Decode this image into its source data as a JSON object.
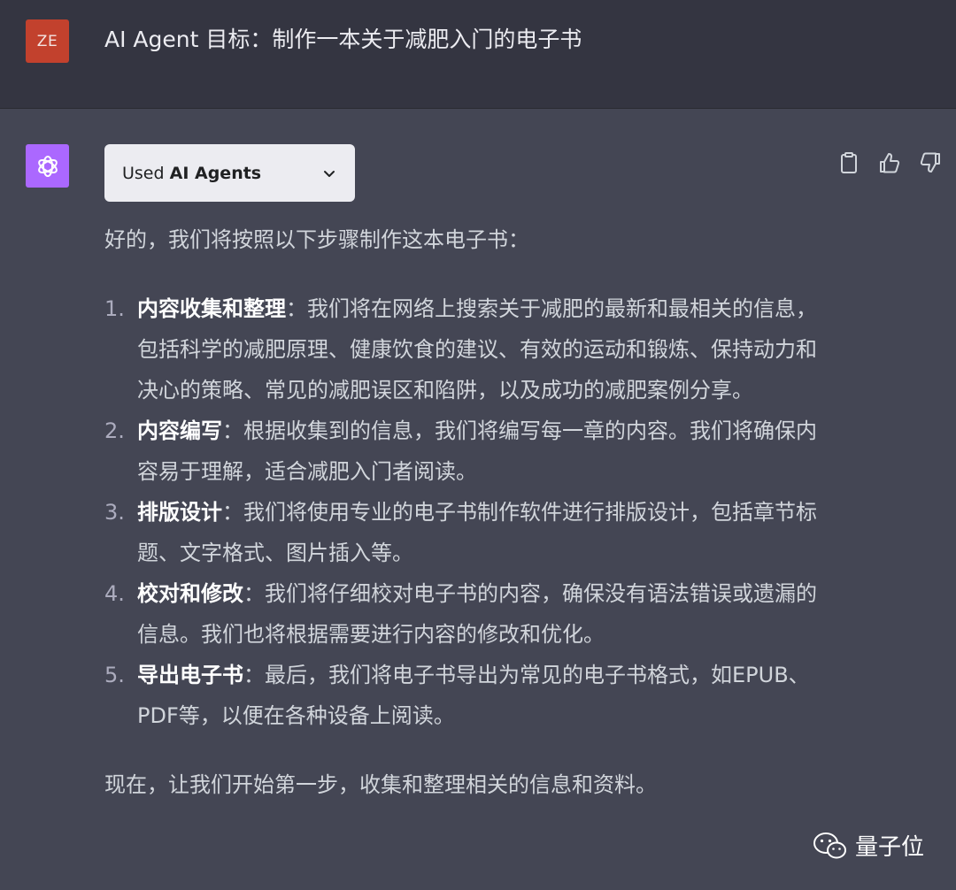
{
  "user_message": {
    "avatar_initials": "ZE",
    "avatar_color": "#c2412d",
    "text": "AI Agent 目标：制作一本关于减肥入门的电子书"
  },
  "assistant": {
    "avatar_icon": "openai-logo-icon",
    "avatar_color": "#ab68ff",
    "tool_prefix": "Used ",
    "tool_name": "AI Agents",
    "actions": [
      "clipboard-icon",
      "thumbs-up-icon",
      "thumbs-down-icon"
    ],
    "intro": "好的，我们将按照以下步骤制作这本电子书：",
    "steps": [
      {
        "number": "1.",
        "title": "内容收集和整理",
        "sep": "：",
        "body": "我们将在网络上搜索关于减肥的最新和最相关的信息，包括科学的减肥原理、健康饮食的建议、有效的运动和锻炼、保持动力和决心的策略、常见的减肥误区和陷阱，以及成功的减肥案例分享。"
      },
      {
        "number": "2.",
        "title": "内容编写",
        "sep": "：",
        "body": "根据收集到的信息，我们将编写每一章的内容。我们将确保内容易于理解，适合减肥入门者阅读。"
      },
      {
        "number": "3.",
        "title": "排版设计",
        "sep": "：",
        "body": "我们将使用专业的电子书制作软件进行排版设计，包括章节标题、文字格式、图片插入等。"
      },
      {
        "number": "4.",
        "title": "校对和修改",
        "sep": "：",
        "body": "我们将仔细校对电子书的内容，确保没有语法错误或遗漏的信息。我们也将根据需要进行内容的修改和优化。"
      },
      {
        "number": "5.",
        "title": "导出电子书",
        "sep": "：",
        "body": "最后，我们将电子书导出为常见的电子书格式，如EPUB、PDF等，以便在各种设备上阅读。"
      }
    ],
    "outro": "现在，让我们开始第一步，收集和整理相关的信息和资料。"
  },
  "watermark": {
    "icon": "wechat-icon",
    "text": "量子位"
  }
}
